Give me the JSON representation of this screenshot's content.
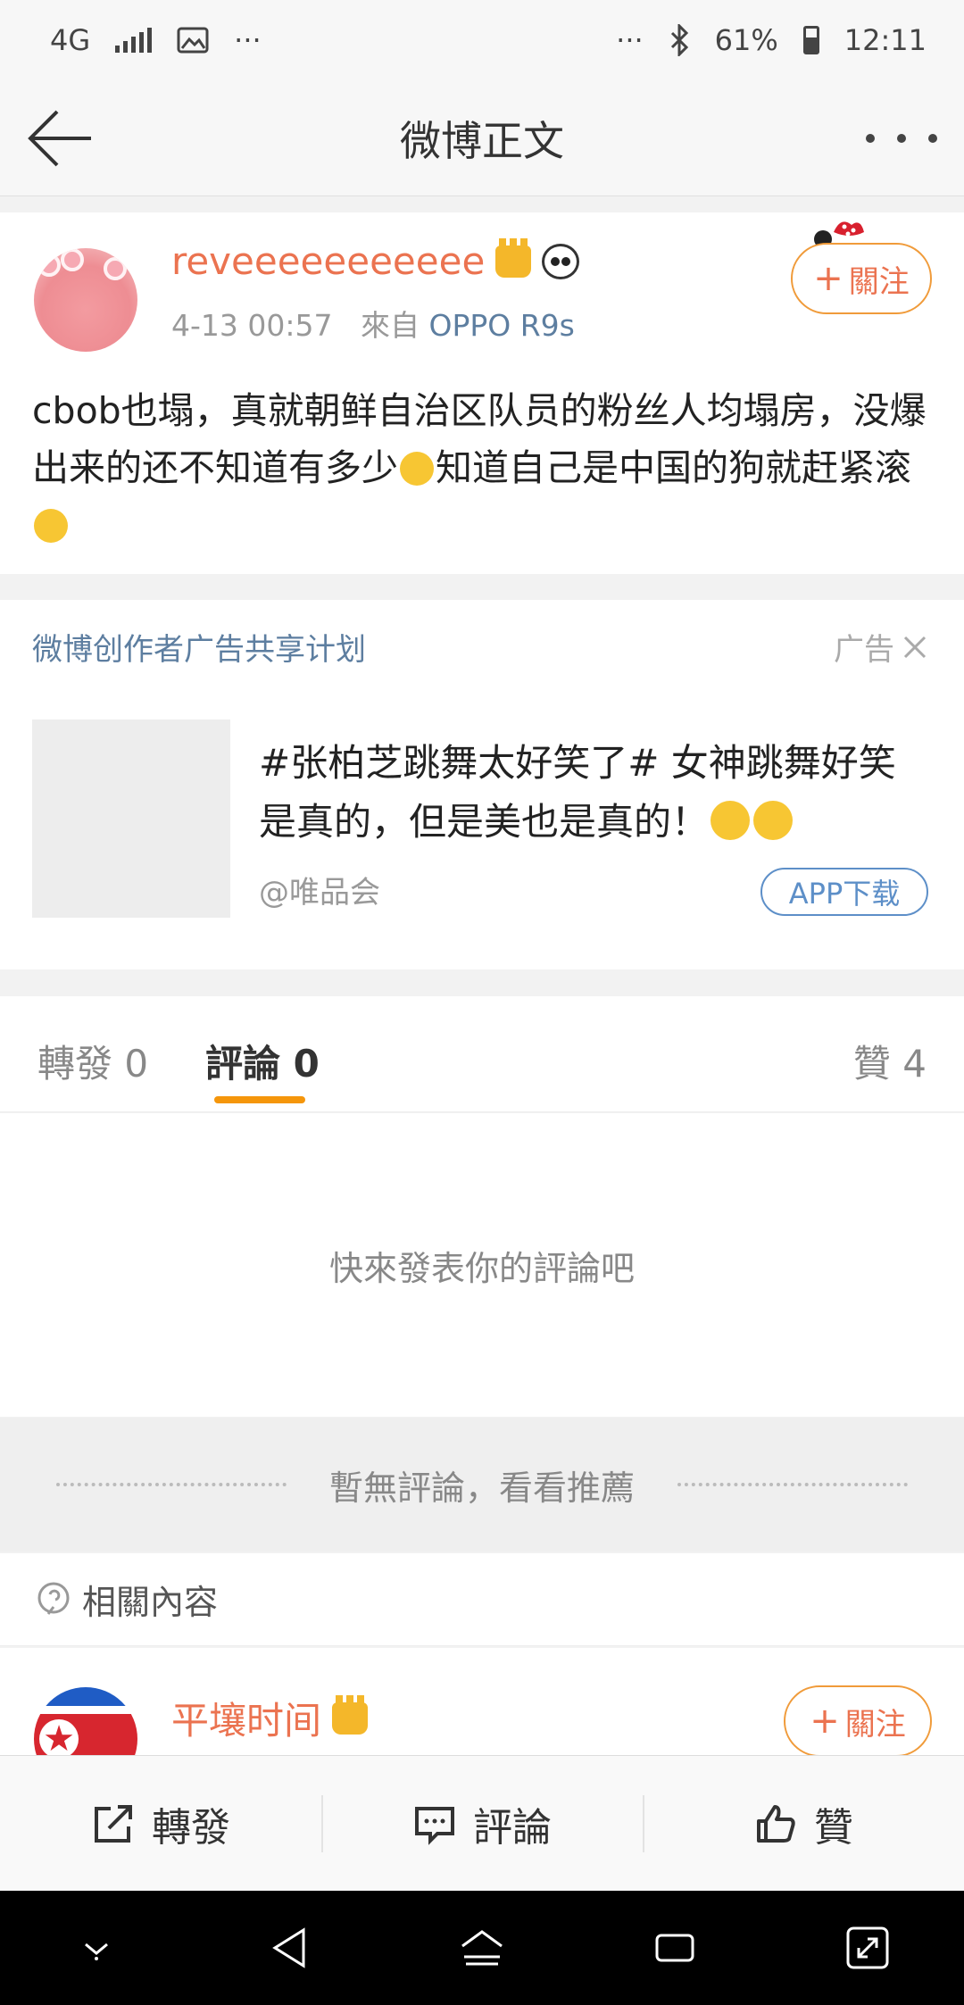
{
  "status_bar": {
    "network": "4G",
    "more": "···",
    "right_more": "···",
    "battery": "61%",
    "time": "12:11"
  },
  "nav": {
    "title": "微博正文"
  },
  "post": {
    "username": "reveeeeeeeeeee",
    "time": "4-13 00:57",
    "source_prefix": "來自",
    "source": "OPPO R9s",
    "follow_label": "關注",
    "text_1": "cbob也塌，真就朝鲜自治区队员的粉丝人均塌房，没爆出来的还不知道有多少",
    "text_2": "知道自己是中国的狗就赶紧滚"
  },
  "ad": {
    "header": "微博创作者广告共享计划",
    "tag": "广告",
    "text": "#张柏芝跳舞太好笑了# 女神跳舞好笑是真的，但是美也是真的！",
    "source": "@唯品会",
    "button": "APP下载"
  },
  "tabs": {
    "repost": "轉發 0",
    "comment": "評論 0",
    "like": "贊 4"
  },
  "comments": {
    "empty": "快來發表你的評論吧"
  },
  "recommend": {
    "divider": "暫無評論，看看推薦"
  },
  "related": {
    "title": "相關內容",
    "username": "平壤时间",
    "follow_label": "關注"
  },
  "toolbar": {
    "repost": "轉發",
    "comment": "評論",
    "like": "贊"
  },
  "colors": {
    "accent_orange": "#eb7350",
    "link_blue": "#5d7ea0",
    "tab_underline": "#f5960b"
  }
}
